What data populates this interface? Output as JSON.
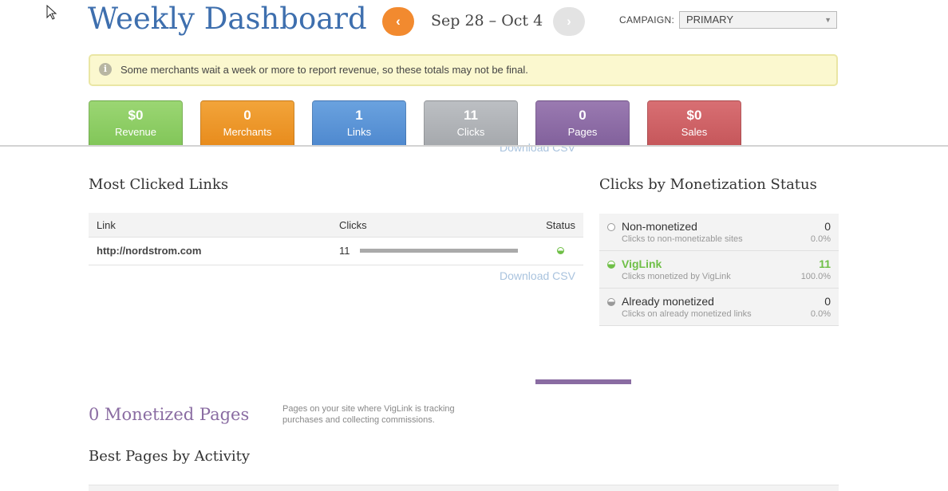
{
  "colors": {
    "title": "#3e6fae",
    "prev_button": "#f28a2f",
    "next_button": "#e3e3e3",
    "notice_bg": "#fbf8cf",
    "revenue": "#8ccc62",
    "merchants": "#ec9626",
    "links": "#5c95d6",
    "clicks": "#b1b4b8",
    "pages": "#8c6ba5",
    "sales": "#cf6266",
    "viglink_green": "#6fbf47",
    "link_blue": "#a9c3de",
    "monetized_pages": "#8a6ca2"
  },
  "header": {
    "title": "Weekly Dashboard",
    "prev_icon": "chevron-left-icon",
    "prev_glyph": "‹",
    "next_icon": "chevron-right-icon",
    "next_glyph": "›",
    "date_range": "Sep 28 – Oct 4",
    "campaign_label": "CAMPAIGN:",
    "campaign_value": "PRIMARY",
    "campaign_arrow": "▼"
  },
  "notice": {
    "icon": "info-icon",
    "icon_glyph": "i",
    "text": "Some merchants wait a week or more to report revenue, so these totals may not be final."
  },
  "tiles": [
    {
      "value": "$0",
      "label": "Revenue"
    },
    {
      "value": "0",
      "label": "Merchants"
    },
    {
      "value": "1",
      "label": "Links"
    },
    {
      "value": "11",
      "label": "Clicks"
    },
    {
      "value": "0",
      "label": "Pages"
    },
    {
      "value": "$0",
      "label": "Sales"
    }
  ],
  "most_clicked": {
    "title": "Most Clicked Links",
    "columns": {
      "link": "Link",
      "clicks": "Clicks",
      "status": "Status"
    },
    "rows": [
      {
        "link": "http://nordstrom.com",
        "clicks": "11",
        "bar_fraction": 1.0,
        "status": "VigLink"
      }
    ],
    "download_label": "Download CSV",
    "ghost_download_label": "Download CSV"
  },
  "monetization": {
    "title": "Clicks by Monetization Status",
    "rows": [
      {
        "name": "Non-monetized",
        "sub": "Clicks to non-monetizable sites",
        "count": "0",
        "pct": "0.0%"
      },
      {
        "name": "VigLink",
        "sub": "Clicks monetized by VigLink",
        "count": "11",
        "pct": "100.0%"
      },
      {
        "name": "Already monetized",
        "sub": "Clicks on already monetized links",
        "count": "0",
        "pct": "0.0%"
      }
    ]
  },
  "pages_section": {
    "monetized_title": "0 Monetized Pages",
    "description": "Pages on your site where VigLink is tracking purchases and collecting commissions.",
    "best_title": "Best Pages by Activity"
  }
}
